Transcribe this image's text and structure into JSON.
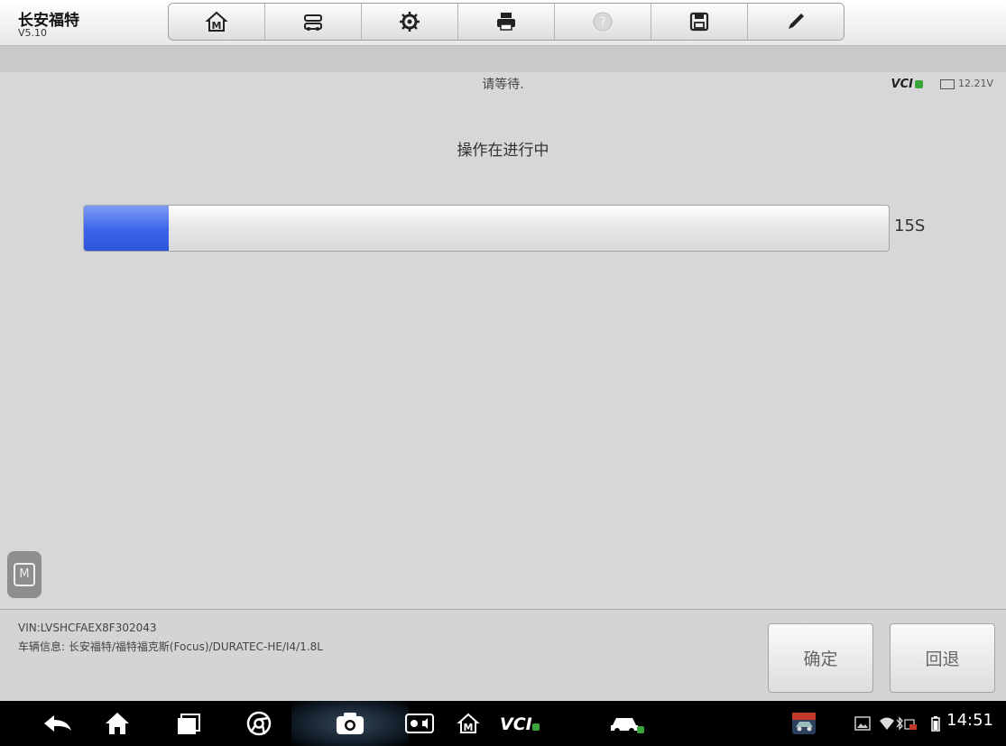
{
  "header": {
    "app_title": "长安福特",
    "version": "V5.10",
    "toolbar": [
      {
        "name": "home-m-icon"
      },
      {
        "name": "vehicle-swap-icon"
      },
      {
        "name": "gear-icon"
      },
      {
        "name": "printer-icon"
      },
      {
        "name": "help-icon"
      },
      {
        "name": "save-icon"
      },
      {
        "name": "pen-icon"
      }
    ]
  },
  "status": {
    "message": "请等待.",
    "vci_label": "VCI",
    "voltage": "12.21V"
  },
  "main": {
    "operation_text": "操作在进行中",
    "progress_fraction": 0.105,
    "progress_label": "15S"
  },
  "footer": {
    "vin": "VIN:LVSHCFAEX8F302043",
    "vehicle_info": "车辆信息: 长安福特/福特福克斯(Focus)/DURATEC-HE/I4/1.8L",
    "ok_label": "确定",
    "back_label": "回退"
  },
  "system_bar": {
    "clock": "14:51"
  },
  "colors": {
    "progress_fill": "#3a63ea",
    "vci_ok": "#3aa53a"
  }
}
